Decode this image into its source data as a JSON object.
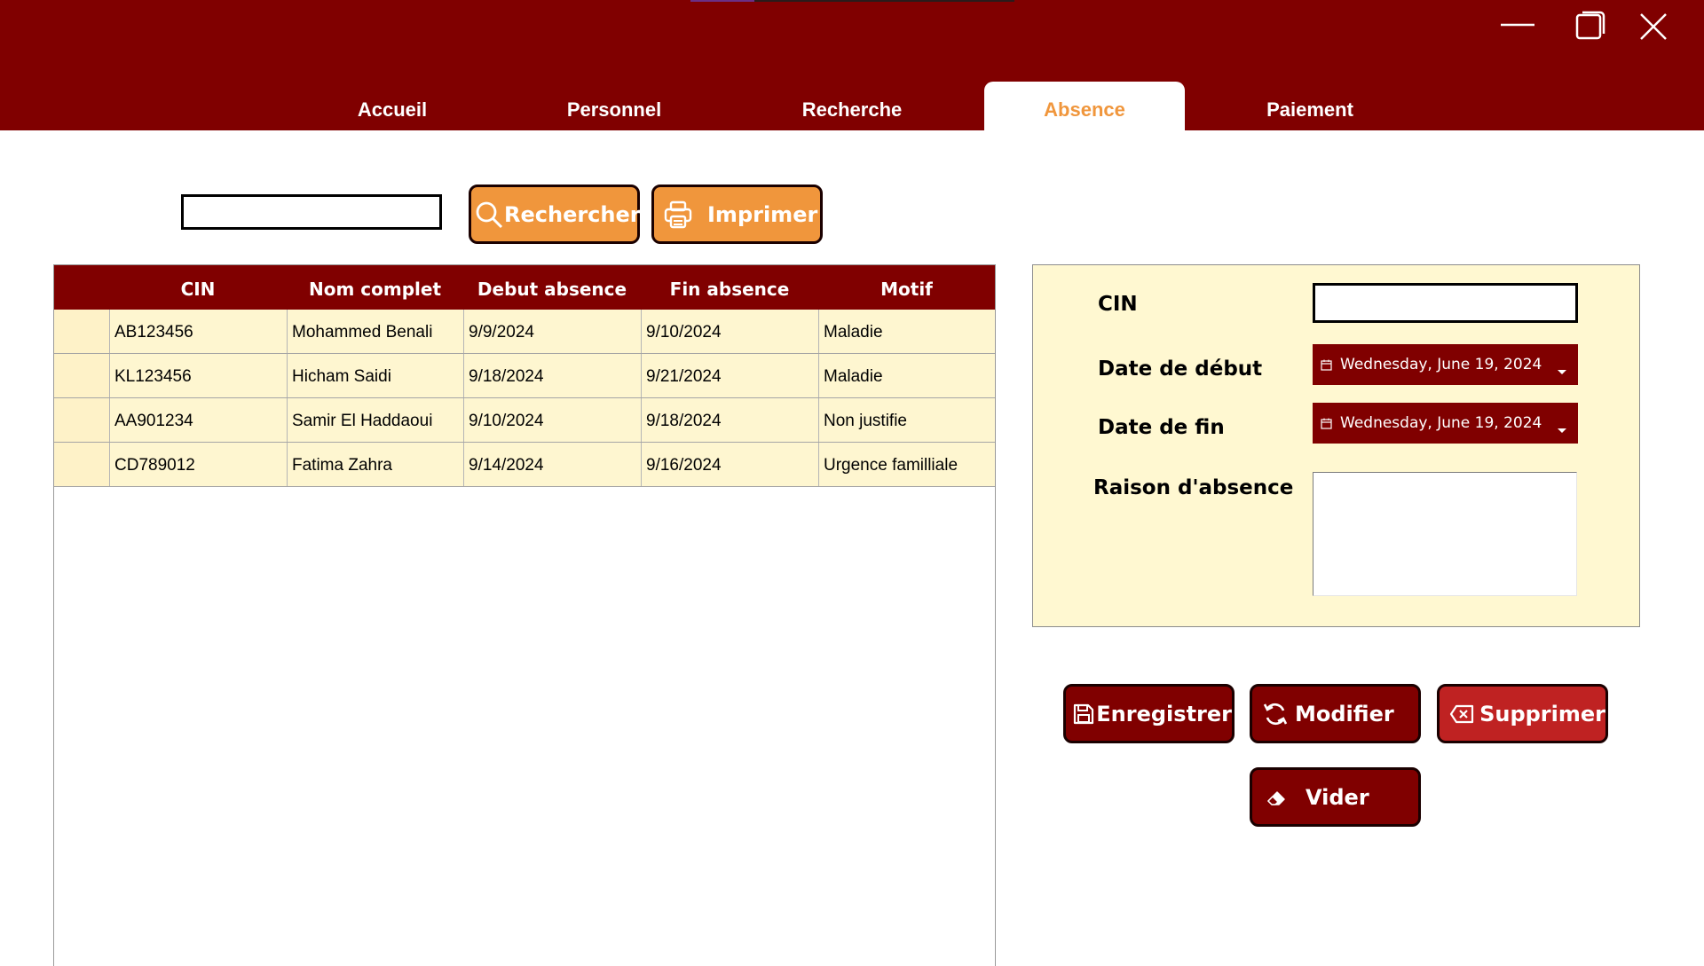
{
  "window": {
    "controls": [
      "minimize-icon",
      "restore-icon",
      "close-icon"
    ]
  },
  "tabs": [
    {
      "label": "Accueil"
    },
    {
      "label": "Personnel"
    },
    {
      "label": "Recherche"
    },
    {
      "label": "Absence",
      "active": true
    },
    {
      "label": "Paiement"
    }
  ],
  "search": {
    "value": "",
    "search_label": "Rechercher",
    "print_label": "Imprimer"
  },
  "table": {
    "columns": [
      "CIN",
      "Nom complet",
      "Debut absence",
      "Fin absence",
      "Motif"
    ],
    "rows": [
      [
        "AB123456",
        "Mohammed Benali",
        "9/9/2024",
        "9/10/2024",
        "Maladie"
      ],
      [
        "KL123456",
        "Hicham Saidi",
        "9/18/2024",
        "9/21/2024",
        "Maladie"
      ],
      [
        "AA901234",
        "Samir El Haddaoui",
        "9/10/2024",
        "9/18/2024",
        "Non justifie"
      ],
      [
        "CD789012",
        "Fatima Zahra",
        "9/14/2024",
        "9/16/2024",
        "Urgence familliale"
      ]
    ]
  },
  "form": {
    "cin_label": "CIN",
    "cin_value": "",
    "start_label": "Date de début",
    "start_value": "Wednesday,  June  19, 2024",
    "end_label": "Date de fin",
    "end_value": "Wednesday,  June  19, 2024",
    "reason_label": "Raison d'absence",
    "reason_value": ""
  },
  "actions": {
    "save_label": "Enregistrer",
    "modify_label": "Modifier",
    "delete_label": "Supprimer",
    "clear_label": "Vider"
  },
  "colors": {
    "brand": "#800000",
    "accent": "#f0963c",
    "danger": "#bf2222",
    "panel": "#fff8d1",
    "row": "#fef6d0"
  }
}
